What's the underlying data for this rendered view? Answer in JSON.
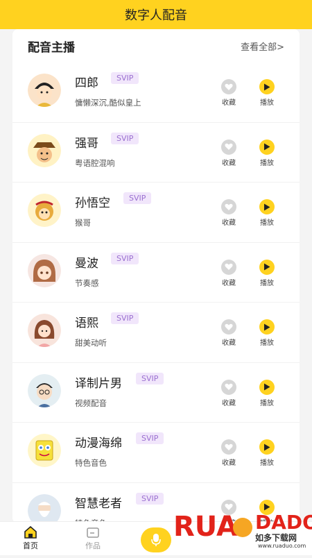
{
  "header": {
    "title": "数字人配音"
  },
  "section": {
    "title": "配音主播",
    "view_all": "查看全部>"
  },
  "actions": {
    "favorite": "收藏",
    "play": "播放"
  },
  "anchors": [
    {
      "name": "四郎",
      "badge": "SVIP",
      "desc": "慵懒深沉,酷似皇上",
      "avatar_icon": "emperor-avatar-icon"
    },
    {
      "name": "强哥",
      "badge": "SVIP",
      "desc": "粤语腔混响",
      "avatar_icon": "man-hat-avatar-icon"
    },
    {
      "name": "孙悟空",
      "badge": "SVIP",
      "desc": "猴哥",
      "avatar_icon": "monkey-king-avatar-icon"
    },
    {
      "name": "曼波",
      "badge": "SVIP",
      "desc": "节奏感",
      "avatar_icon": "girl-avatar-icon"
    },
    {
      "name": "语熙",
      "badge": "SVIP",
      "desc": "甜美动听",
      "avatar_icon": "woman-avatar-icon"
    },
    {
      "name": "译制片男",
      "badge": "SVIP",
      "desc": "视频配音",
      "avatar_icon": "man-glasses-avatar-icon"
    },
    {
      "name": "动漫海绵",
      "badge": "SVIP",
      "desc": "特色音色",
      "avatar_icon": "sponge-avatar-icon"
    },
    {
      "name": "智慧老者",
      "badge": "SVIP",
      "desc": "特色音色",
      "avatar_icon": "old-man-avatar-icon"
    }
  ],
  "tabs": {
    "home": "首页",
    "works": "作品"
  },
  "watermark": {
    "brand": "RUADADO",
    "cn": "如多下载网",
    "url": "www.ruaduo.com"
  },
  "colors": {
    "accent": "#ffd21f",
    "badge_text": "#9a6fd0",
    "badge_bg": "#f1e6fb"
  }
}
